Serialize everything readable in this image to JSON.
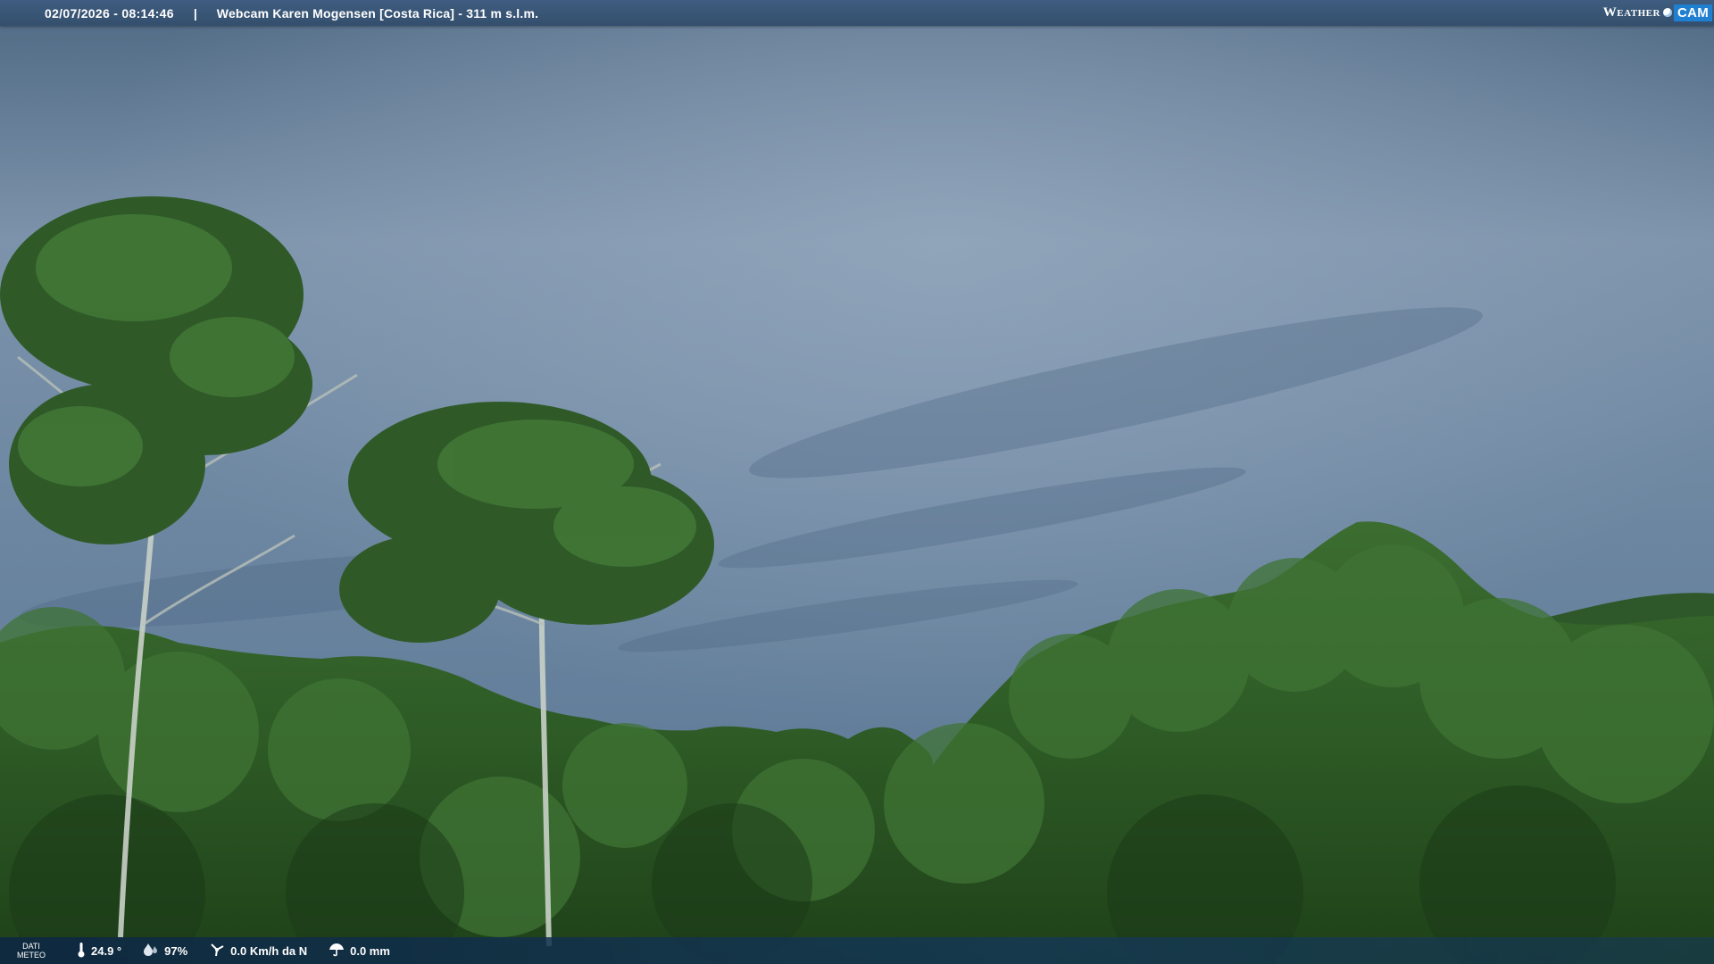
{
  "header": {
    "datetime": "02/07/2026 - 08:14:46",
    "separator": "|",
    "title": "Webcam Karen Mogensen [Costa Rica]  - 311 m s.l.m."
  },
  "logo": {
    "weather_text": "Weather",
    "cam_text": "CAM"
  },
  "footer": {
    "dati_label_1": "DATI",
    "dati_label_2": "METEO",
    "temperature": "24.9 °",
    "humidity": "97%",
    "wind": "0.0 Km/h da N",
    "rain": "0.0 mm"
  },
  "icons": {
    "temperature": "thermometer-icon",
    "humidity": "humidity-drop-icon",
    "wind": "wind-icon",
    "rain": "rain-umbrella-icon"
  },
  "colors": {
    "sky": "#6f8aa7",
    "forest": "#2e5a26",
    "header_bar": "#3f5d80",
    "logo_accent": "#1f7fd0"
  }
}
